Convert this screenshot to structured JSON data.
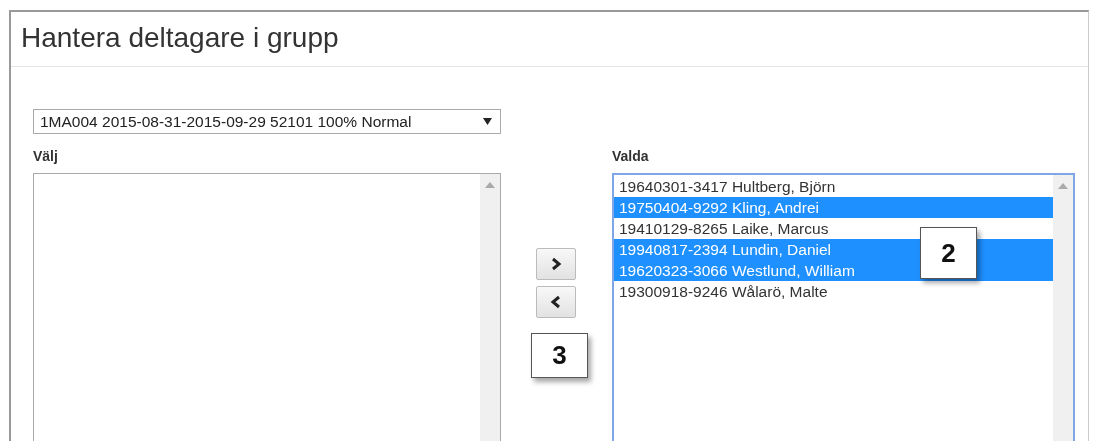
{
  "title": "Hantera deltagare i grupp",
  "group_select": {
    "value": "1MA004 2015-08-31-2015-09-29 52101 100% Normal"
  },
  "available": {
    "label": "Välj"
  },
  "move_buttons": [
    {
      "kind": "right"
    },
    {
      "kind": "left"
    }
  ],
  "chosen": {
    "label": "Valda",
    "items": [
      {
        "text": "19640301-3417 Hultberg, Björn",
        "selected": false
      },
      {
        "text": "19750404-9292 Kling, Andrei",
        "selected": true
      },
      {
        "text": "19410129-8265 Laike, Marcus",
        "selected": false
      },
      {
        "text": "19940817-2394 Lundin, Daniel",
        "selected": true
      },
      {
        "text": "19620323-3066 Westlund, William",
        "selected": true
      },
      {
        "text": "19300918-9246 Wålarö, Malte",
        "selected": false
      }
    ]
  },
  "callouts": [
    {
      "label": "2"
    },
    {
      "label": "3"
    }
  ]
}
